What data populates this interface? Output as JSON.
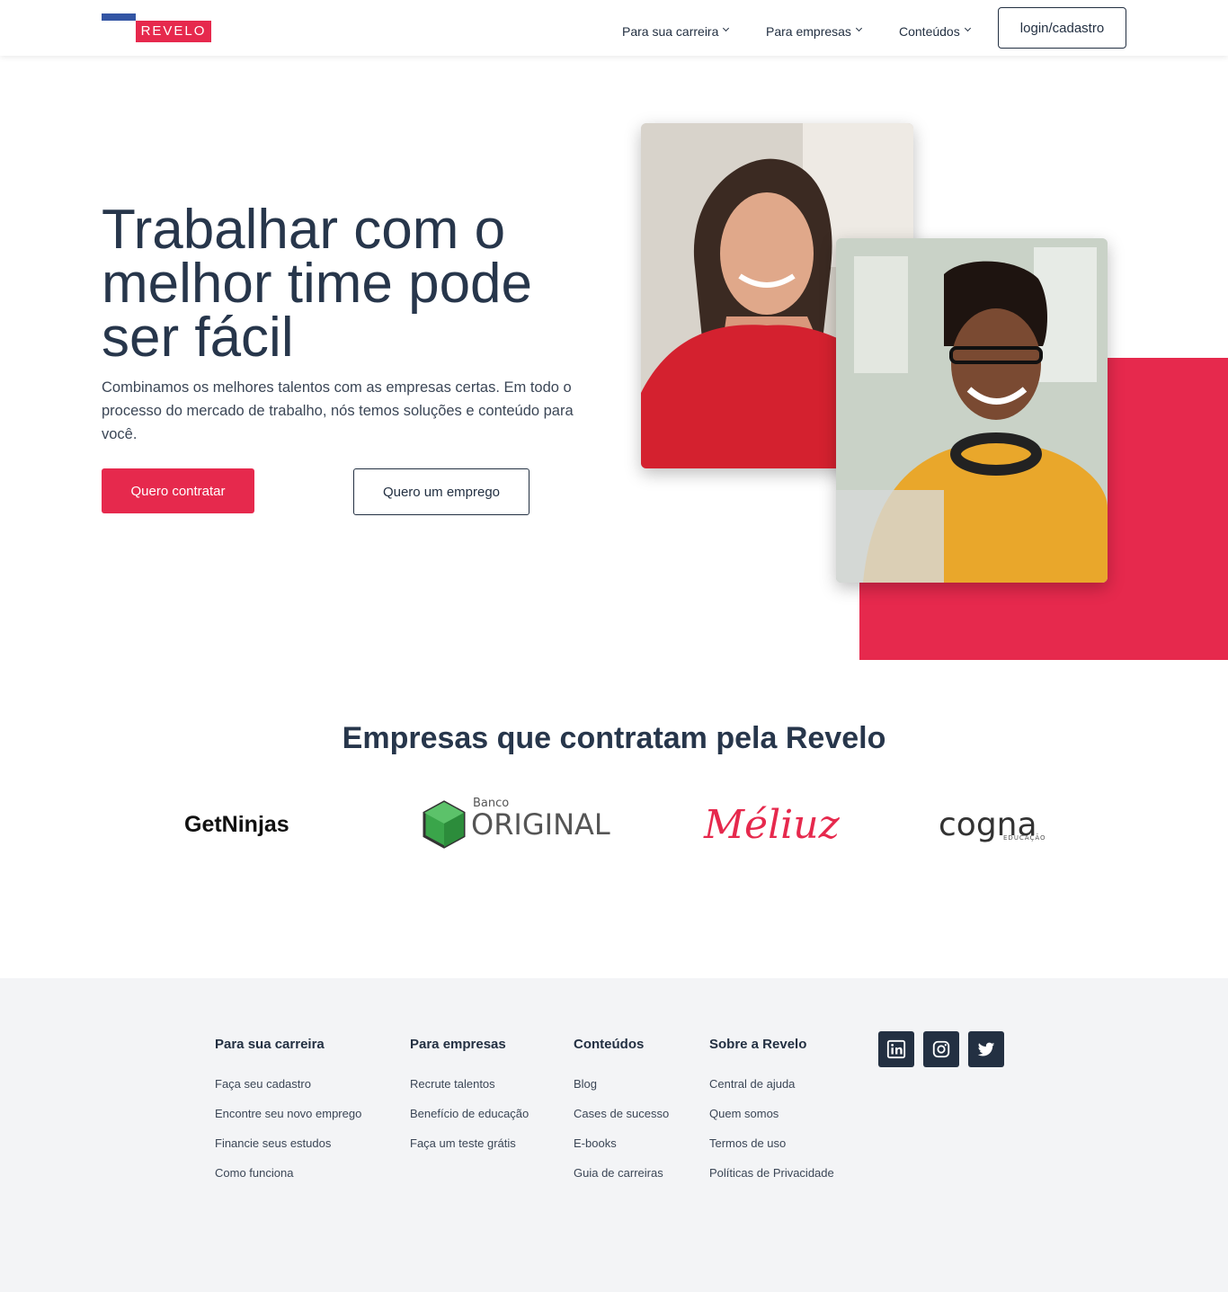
{
  "header": {
    "logo_text": "REVELO",
    "nav": [
      {
        "label": "Para sua carreira"
      },
      {
        "label": "Para empresas"
      },
      {
        "label": "Conteúdos"
      }
    ],
    "login_label": "login/cadastro"
  },
  "hero": {
    "title": "Trabalhar com o melhor time pode ser fácil",
    "subtitle": "Combinamos os melhores talentos com as empresas certas. Em todo o processo do mercado de trabalho, nós temos soluções e conteúdo para você.",
    "primary_button": "Quero contratar",
    "secondary_button": "Quero um emprego"
  },
  "companies": {
    "title": "Empresas que contratam pela Revelo",
    "logos": [
      {
        "name": "GetNinjas"
      },
      {
        "name": "ORIGINAL",
        "prefix": "Banco"
      },
      {
        "name": "Méliuz"
      },
      {
        "name": "cogna",
        "suffix": "EDUCAÇÃO"
      }
    ]
  },
  "footer": {
    "columns": [
      {
        "title": "Para sua carreira",
        "links": [
          "Faça seu cadastro",
          "Encontre seu novo emprego",
          "Financie seus estudos",
          "Como funciona"
        ]
      },
      {
        "title": "Para empresas",
        "links": [
          "Recrute talentos",
          "Benefício de educação",
          "Faça um teste grátis"
        ]
      },
      {
        "title": "Conteúdos",
        "links": [
          "Blog",
          "Cases de sucesso",
          "E-books",
          "Guia de carreiras"
        ]
      },
      {
        "title": "Sobre a Revelo",
        "links": [
          "Central de ajuda",
          "Quem somos",
          "Termos de uso",
          "Políticas de Privacidade"
        ]
      }
    ],
    "social": [
      {
        "icon": "linkedin-icon"
      },
      {
        "icon": "instagram-icon"
      },
      {
        "icon": "twitter-icon"
      }
    ]
  },
  "colors": {
    "brand_red": "#e6294d",
    "brand_blue": "#3355a4",
    "text_dark": "#233042",
    "footer_bg": "#f3f4f6"
  }
}
